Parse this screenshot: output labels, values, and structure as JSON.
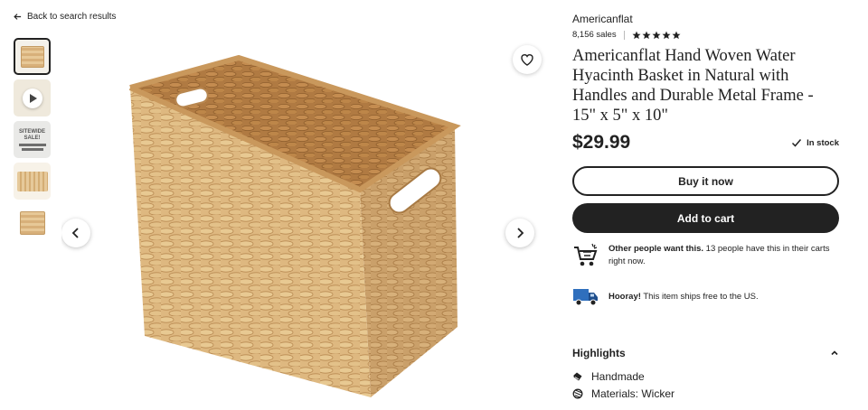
{
  "nav": {
    "back_label": "Back to search results"
  },
  "gallery": {
    "thumbnails": [
      {
        "kind": "photo",
        "active": true
      },
      {
        "kind": "video",
        "active": false
      },
      {
        "kind": "sale",
        "active": false,
        "text_1": "SITEWIDE",
        "text_2": "SALE!"
      },
      {
        "kind": "photo",
        "active": false
      },
      {
        "kind": "photo",
        "active": false
      }
    ],
    "prev_icon": "chevron-left-icon",
    "next_icon": "chevron-right-icon",
    "favorite_icon": "heart-icon"
  },
  "product": {
    "shop_name": "Americanflat",
    "sales": "8,156 sales",
    "rating_stars": 5,
    "title": "Americanflat Hand Woven Water Hyacinth Basket in Natural with Handles and Durable Metal Frame - 15\" x 5\" x 10\"",
    "price": "$29.99",
    "stock_label": "In stock"
  },
  "actions": {
    "buy_now_label": "Buy it now",
    "add_to_cart_label": "Add to cart"
  },
  "notices": {
    "demand_bold": "Other people want this.",
    "demand_text": " 13 people have this in their carts right now.",
    "shipping_bold": "Hooray!",
    "shipping_text": " This item ships free to the US."
  },
  "highlights": {
    "heading": "Highlights",
    "items": [
      {
        "icon": "hand-icon",
        "label": "Handmade"
      },
      {
        "icon": "materials-icon",
        "label": "Materials: Wicker"
      }
    ]
  },
  "colors": {
    "text": "#222222",
    "button_dark": "#222222",
    "truck_blue": "#2f6fbd"
  }
}
